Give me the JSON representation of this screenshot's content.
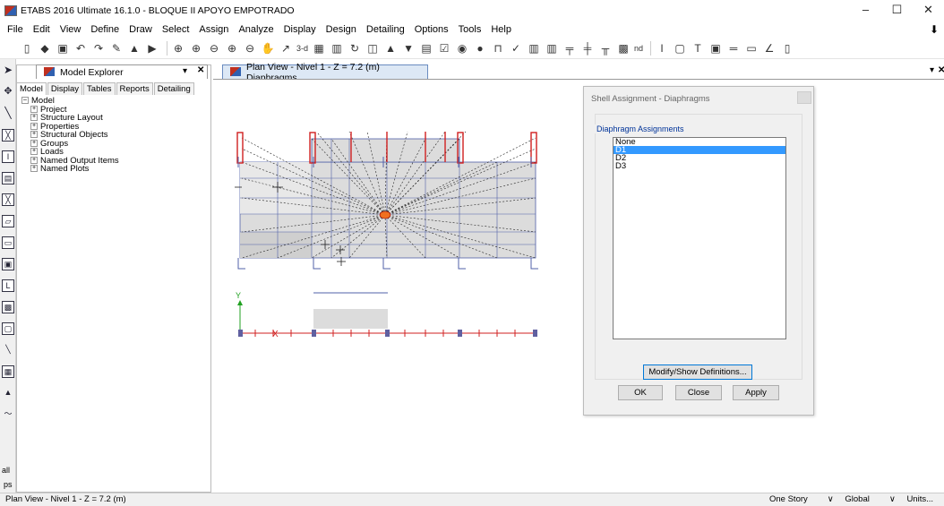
{
  "window": {
    "title": "ETABS 2016 Ultimate 16.1.0 - BLOQUE II APOYO EMPOTRADO",
    "controls": [
      "–",
      "☐",
      "✕"
    ]
  },
  "menu": [
    "File",
    "Edit",
    "View",
    "Define",
    "Draw",
    "Select",
    "Assign",
    "Analyze",
    "Display",
    "Design",
    "Detailing",
    "Options",
    "Tools",
    "Help"
  ],
  "toolbar_text": {
    "view3d": "3-d",
    "nd": "nd"
  },
  "explorer": {
    "tab_label": "Model Explorer",
    "subtabs": [
      "Model",
      "Display",
      "Tables",
      "Reports",
      "Detailing"
    ],
    "root": "Model",
    "items": [
      "Project",
      "Structure Layout",
      "Properties",
      "Structural Objects",
      "Groups",
      "Loads",
      "Named Output Items",
      "Named Plots"
    ]
  },
  "plan_tab": {
    "label": "Plan View - Nivel 1 - Z = 7.2 (m)  Diaphragms"
  },
  "axes": {
    "y": "Y",
    "x": "X"
  },
  "dialog": {
    "title": "Shell Assignment - Diaphragms",
    "group_label": "Diaphragm Assignments",
    "options": [
      "None",
      "D1",
      "D2",
      "D3"
    ],
    "selected": "D1",
    "modify_button": "Modify/Show Definitions...",
    "ok_button": "OK",
    "close_button": "Close",
    "apply_button": "Apply"
  },
  "status": {
    "left": "Plan View - Nivel 1 - Z = 7.2 (m)",
    "story": "One Story",
    "coord": "Global",
    "units": "Units..."
  }
}
